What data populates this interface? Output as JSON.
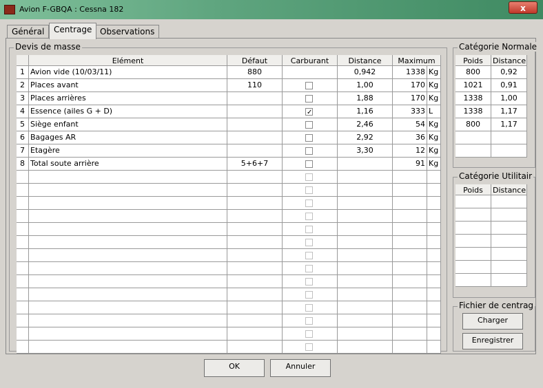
{
  "window": {
    "title": "Avion F-GBQA : Cessna 182",
    "close_label": "x"
  },
  "tabs": [
    {
      "label": "Général"
    },
    {
      "label": "Centrage"
    },
    {
      "label": "Observations"
    }
  ],
  "devis": {
    "group_title": "Devis de masse",
    "headers": {
      "element": "Elément",
      "defaut": "Défaut",
      "carburant": "Carburant",
      "distance": "Distance",
      "maximum": "Maximum"
    },
    "rows": [
      {
        "num": "1",
        "element": "Avion vide (10/03/11)",
        "defaut": "880",
        "carburant": null,
        "distance": "0,942",
        "maximum": "1338",
        "unit": "Kg"
      },
      {
        "num": "2",
        "element": "Places avant",
        "defaut": "110",
        "carburant": false,
        "distance": "1,00",
        "maximum": "170",
        "unit": "Kg"
      },
      {
        "num": "3",
        "element": "Places arrières",
        "defaut": "",
        "carburant": false,
        "distance": "1,88",
        "maximum": "170",
        "unit": "Kg"
      },
      {
        "num": "4",
        "element": "Essence (ailes G + D)",
        "defaut": "",
        "carburant": true,
        "distance": "1,16",
        "maximum": "333",
        "unit": "L"
      },
      {
        "num": "5",
        "element": "Siège enfant",
        "defaut": "",
        "carburant": false,
        "distance": "2,46",
        "maximum": "54",
        "unit": "Kg"
      },
      {
        "num": "6",
        "element": "Bagages AR",
        "defaut": "",
        "carburant": false,
        "distance": "2,92",
        "maximum": "36",
        "unit": "Kg"
      },
      {
        "num": "7",
        "element": "Etagère",
        "defaut": "",
        "carburant": false,
        "distance": "3,30",
        "maximum": "12",
        "unit": "Kg"
      },
      {
        "num": "8",
        "element": "Total soute arrière",
        "defaut": "5+6+7",
        "carburant": false,
        "distance": "",
        "maximum": "91",
        "unit": "Kg"
      }
    ],
    "empty_rows": 14
  },
  "normale": {
    "group_title": "Catégorie Normale",
    "headers": {
      "poids": "Poids",
      "distance": "Distance"
    },
    "rows": [
      {
        "poids": "800",
        "distance": "0,92"
      },
      {
        "poids": "1021",
        "distance": "0,91"
      },
      {
        "poids": "1338",
        "distance": "1,00"
      },
      {
        "poids": "1338",
        "distance": "1,17"
      },
      {
        "poids": "800",
        "distance": "1,17"
      },
      {
        "poids": "",
        "distance": ""
      },
      {
        "poids": "",
        "distance": ""
      }
    ]
  },
  "utilitaire": {
    "group_title": "Catégorie Utilitair",
    "headers": {
      "poids": "Poids",
      "distance": "Distance"
    },
    "empty_rows": 7
  },
  "fichier": {
    "group_title": "Fichier de centrag",
    "load_label": "Charger",
    "save_label": "Enregistrer"
  },
  "buttons": {
    "ok_label": "OK",
    "cancel_label": "Annuler"
  }
}
